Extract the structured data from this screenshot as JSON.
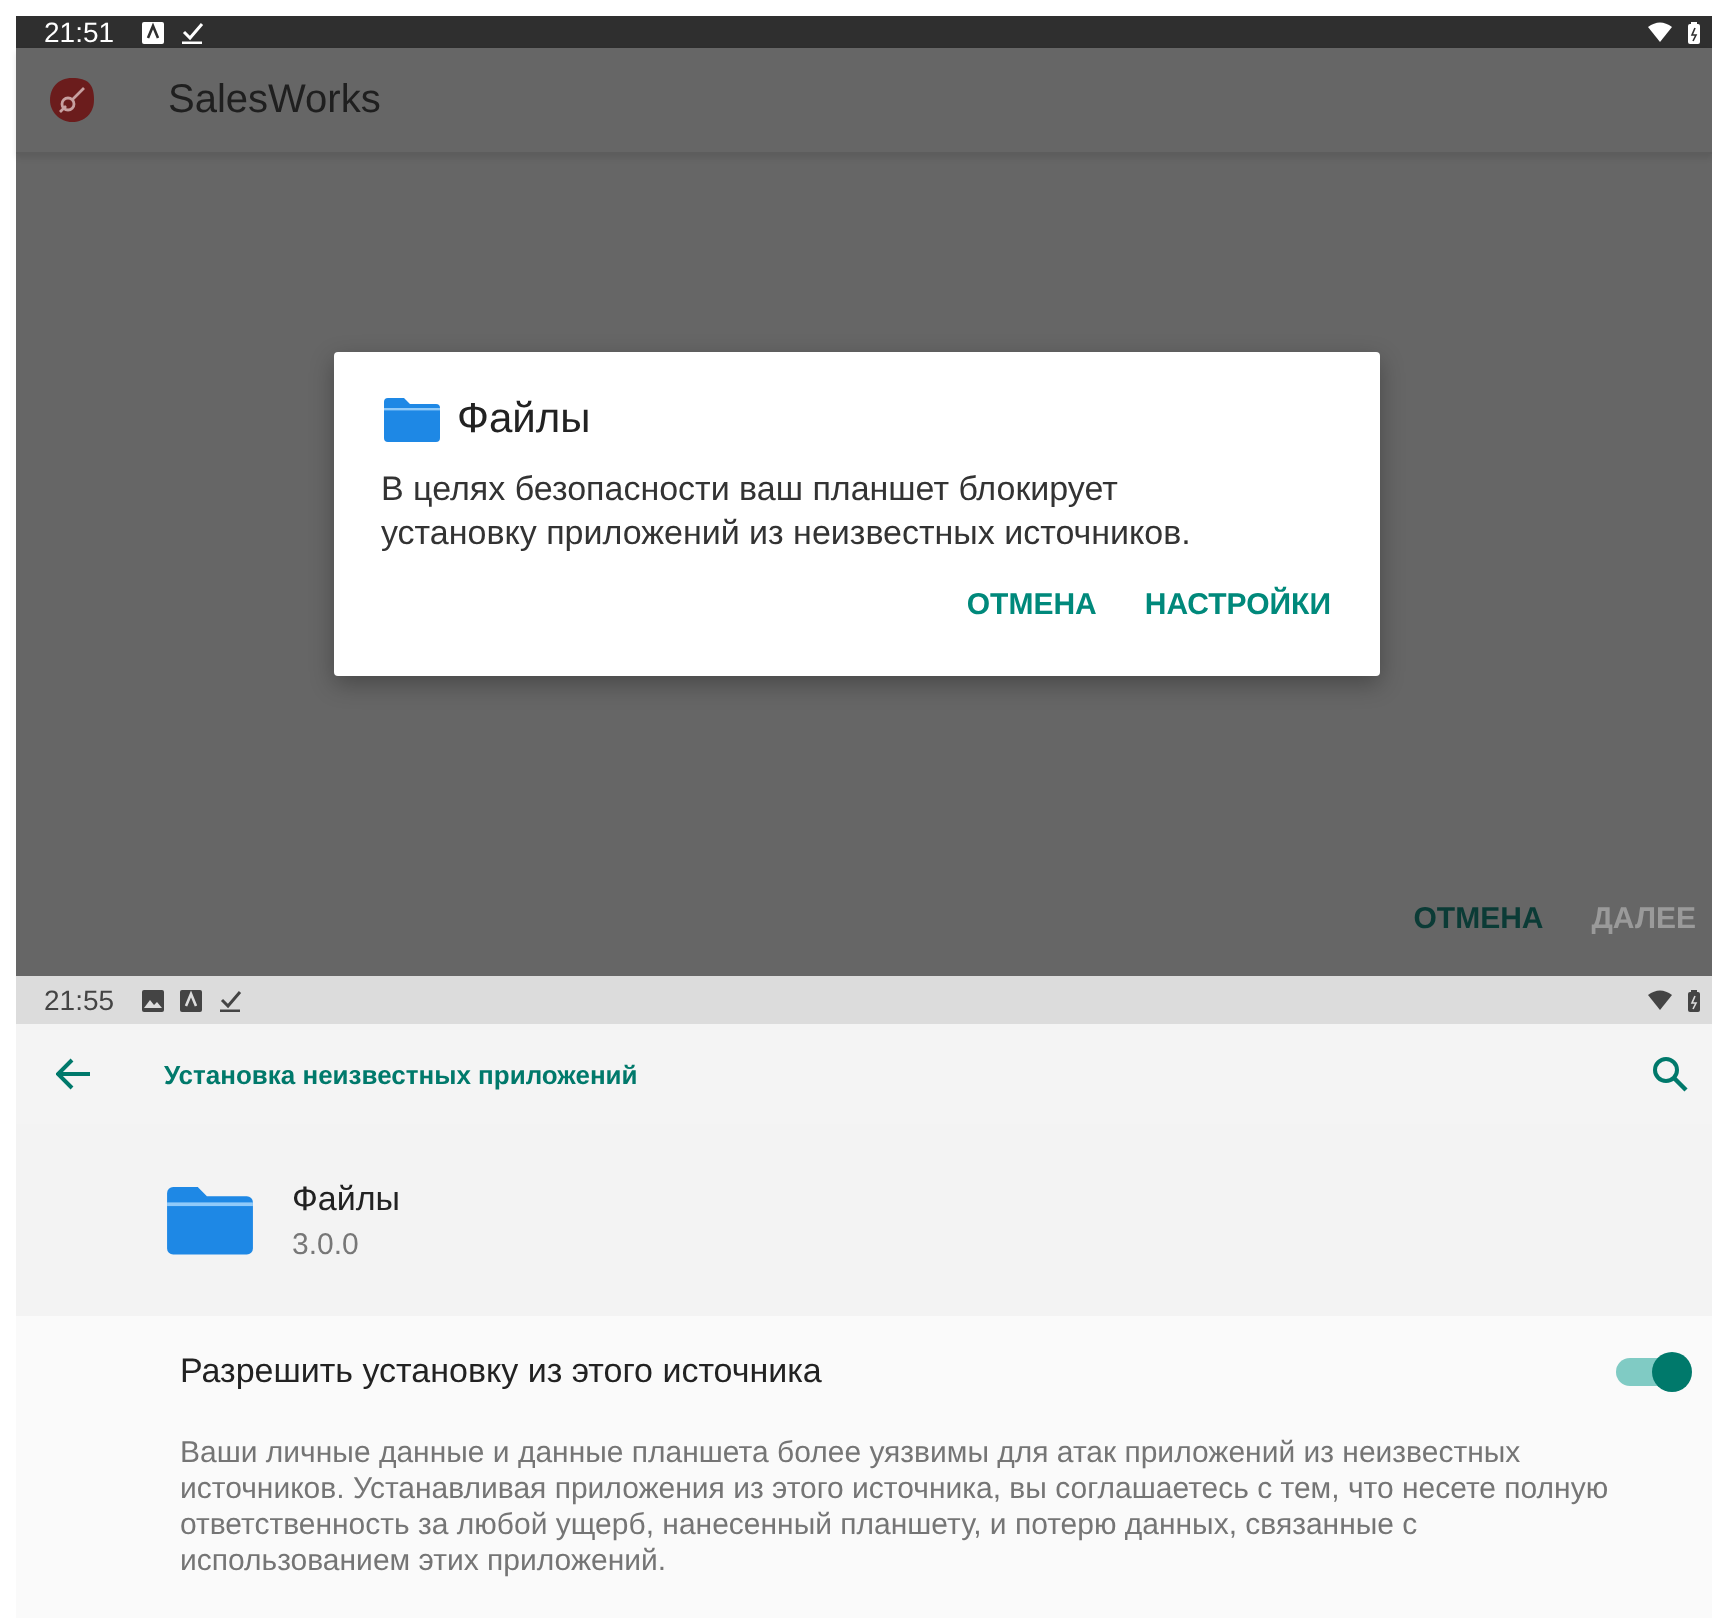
{
  "top_screen": {
    "status_bar": {
      "time": "21:51"
    },
    "app_bar": {
      "title": "SalesWorks"
    },
    "dialog": {
      "title": "Файлы",
      "message": "В целях безопасности ваш планшет блокирует установку приложений из неизвестных источников.",
      "buttons": [
        {
          "label": "ОТМЕНА",
          "disabled": false
        },
        {
          "label": "НАСТРОЙКИ",
          "disabled": false
        }
      ]
    },
    "bottom_buttons": [
      {
        "label": "ОТМЕНА",
        "disabled": false
      },
      {
        "label": "ДАЛЕЕ",
        "disabled": true
      }
    ]
  },
  "bottom_screen": {
    "status_bar": {
      "time": "21:55"
    },
    "toolbar": {
      "title": "Установка неизвестных приложений"
    },
    "app": {
      "name": "Файлы",
      "version": "3.0.0"
    },
    "setting": {
      "label": "Разрешить установку из этого источника",
      "on": true
    },
    "description": "Ваши личные данные и данные планшета более уязвимы для атак приложений из неизвестных источников. Устанавливая приложения из этого источника, вы соглашаетесь с тем, что несете полную ответственность за любой ущерб, нанесенный планшету, и потерю данных, связанные с использованием этих приложений."
  }
}
